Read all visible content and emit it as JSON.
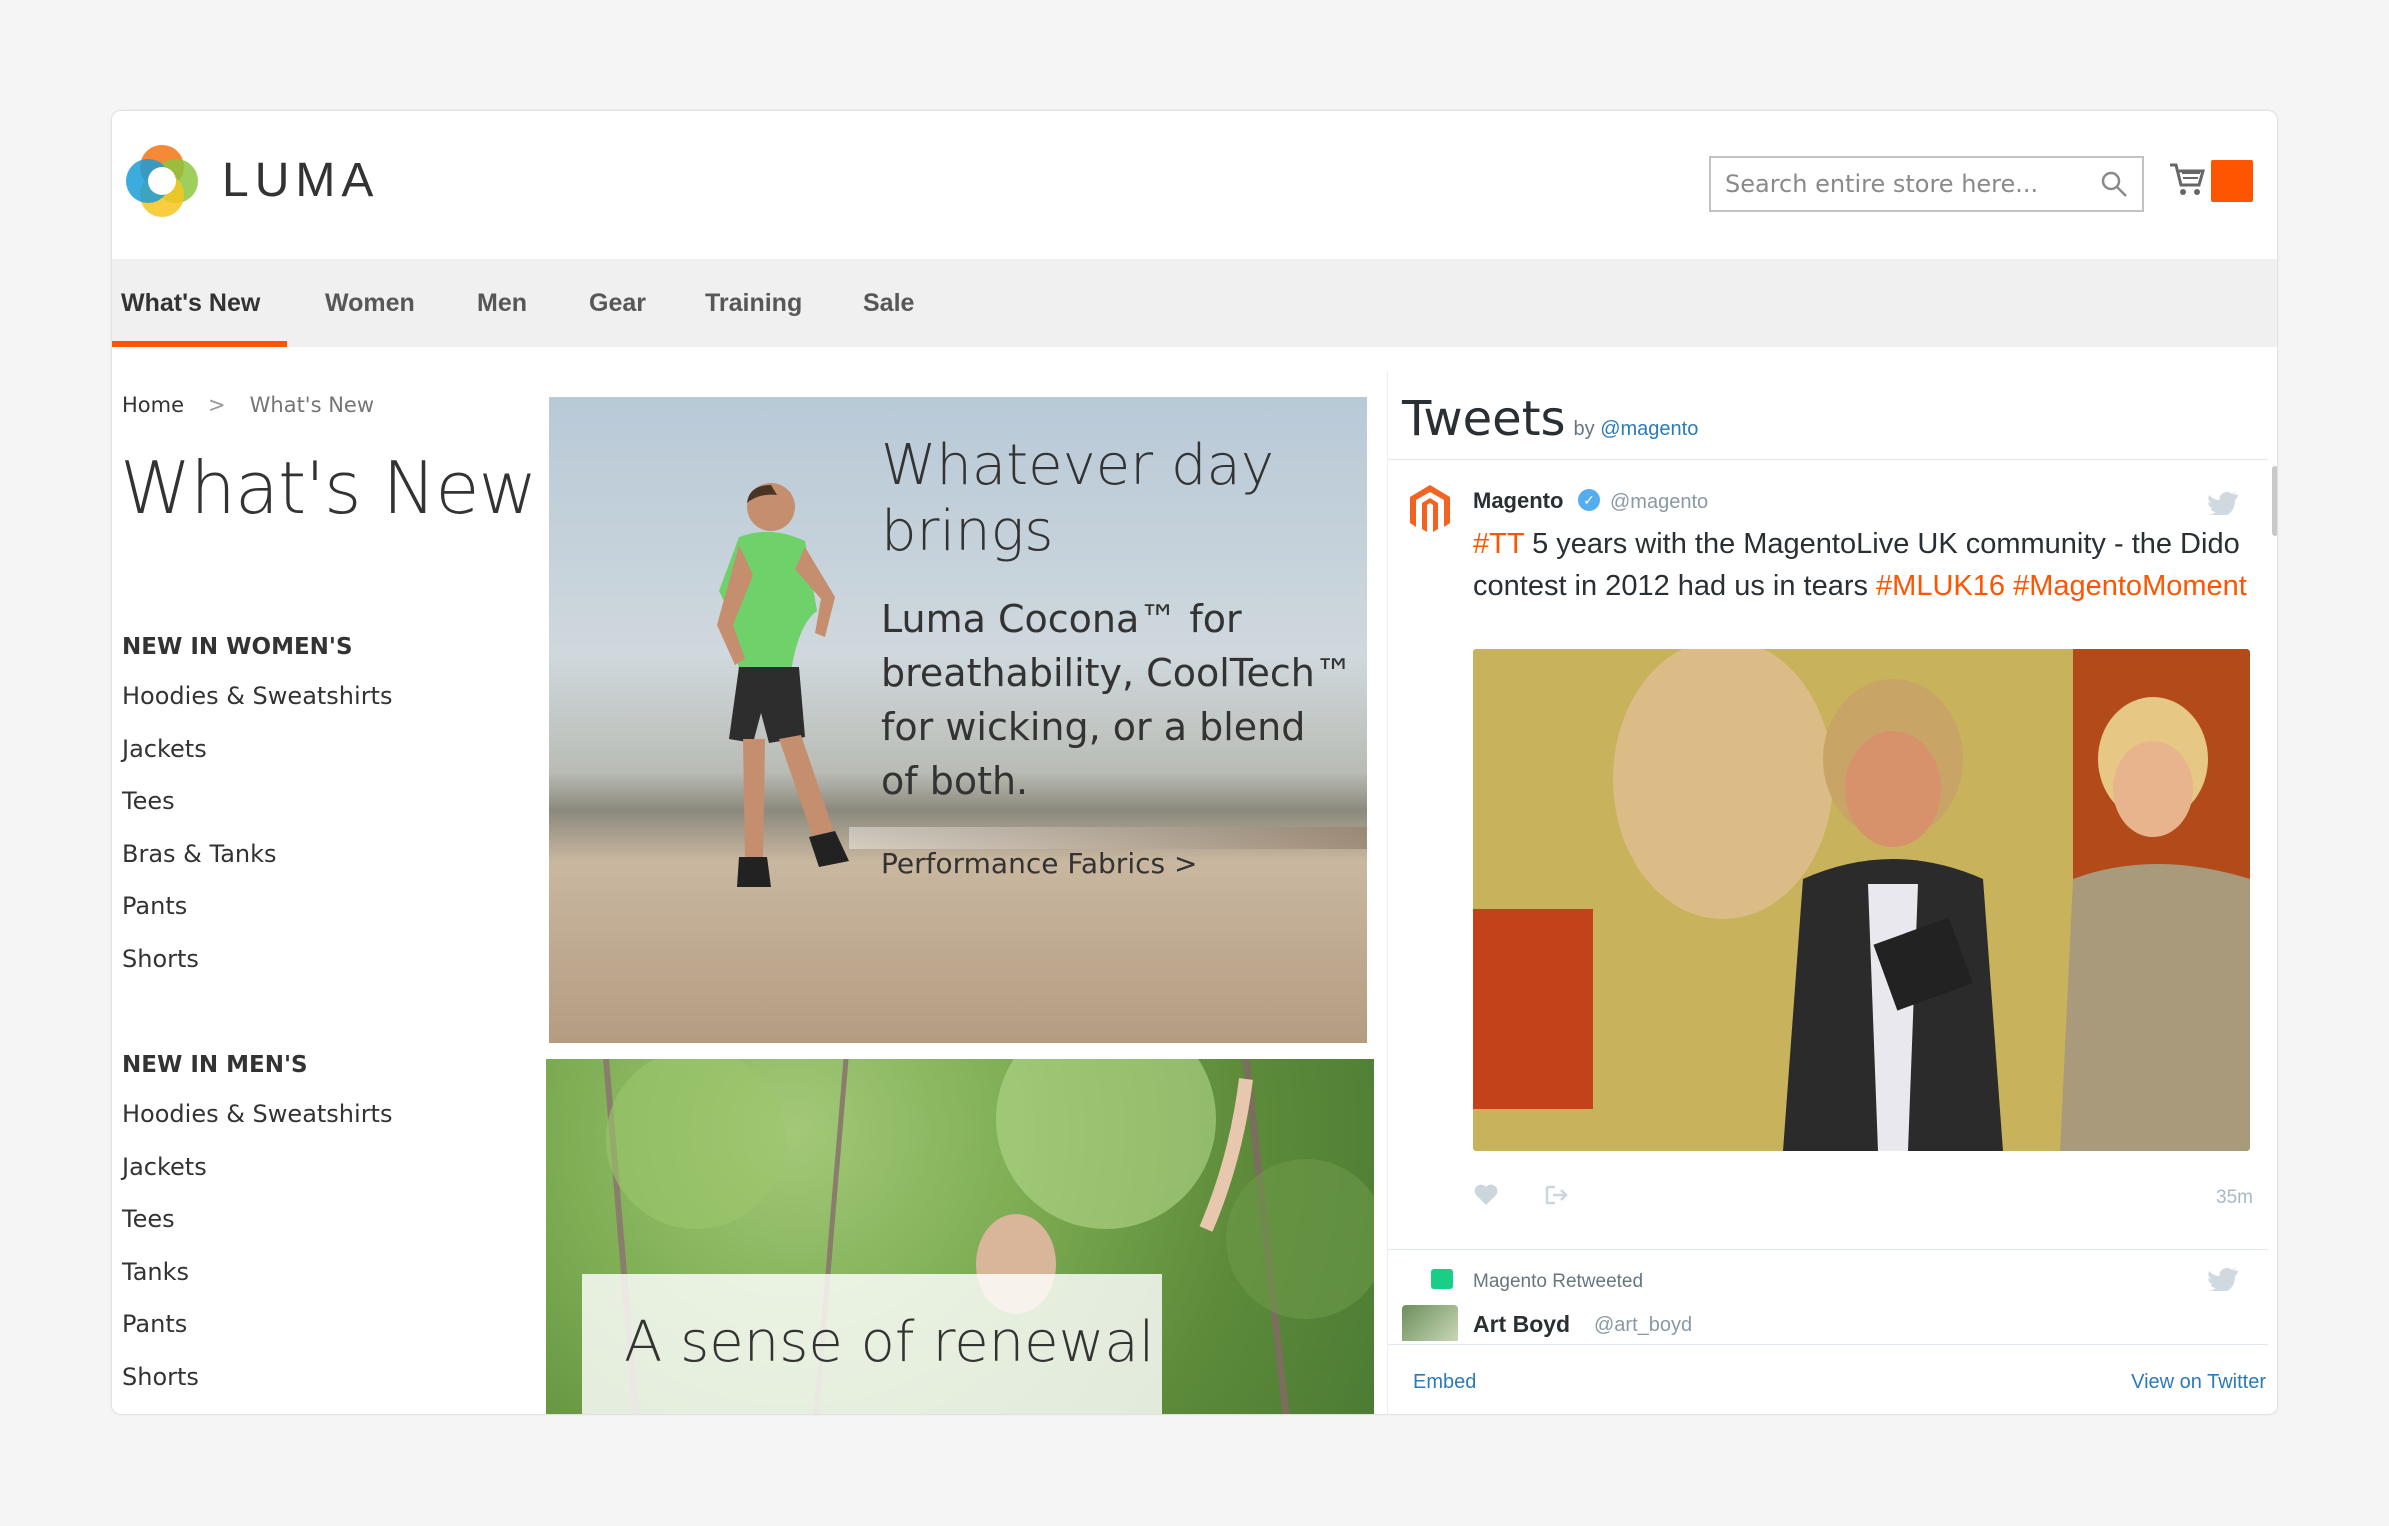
{
  "brand": {
    "name": "LUMA",
    "accent": "#ff5501"
  },
  "search": {
    "placeholder": "Search entire store here...",
    "icon": "search-icon"
  },
  "nav": {
    "items": [
      "What's New",
      "Women",
      "Men",
      "Gear",
      "Training",
      "Sale"
    ],
    "active": "What's New"
  },
  "breadcrumb": {
    "home": "Home",
    "separator": ">",
    "current": "What's New"
  },
  "page": {
    "title": "What's New"
  },
  "women": {
    "heading": "NEW IN WOMEN'S",
    "items": [
      "Hoodies & Sweatshirts",
      "Jackets",
      "Tees",
      "Bras & Tanks",
      "Pants",
      "Shorts"
    ]
  },
  "men": {
    "heading": "NEW IN MEN'S",
    "items": [
      "Hoodies & Sweatshirts",
      "Jackets",
      "Tees",
      "Tanks",
      "Pants",
      "Shorts"
    ]
  },
  "promo1": {
    "title_line1": "Whatever day",
    "title_line2": "brings",
    "body_line1": "Luma Cocona™ for",
    "body_line2": "breathability, CoolTech™",
    "body_line3": "for wicking, or a blend",
    "body_line4": "of both.",
    "link": "Performance Fabrics >"
  },
  "promo2": {
    "caption": "A sense of renewal"
  },
  "tweets": {
    "title": "Tweets",
    "by": "by",
    "by_handle": "@magento",
    "tweet": {
      "name": "Magento",
      "handle": "@magento",
      "hash1": "#TT",
      "text1": " 5 years with the MagentoLive UK community - the Dido contest in 2012 had us in tears ",
      "hash2": "#MLUK16",
      "hash3": "#MagentoMoment",
      "time": "35m"
    },
    "retweet": {
      "label": "Magento Retweeted",
      "name": "Art Boyd",
      "handle": "@art_boyd"
    },
    "embed": "Embed",
    "view": "View on Twitter"
  }
}
